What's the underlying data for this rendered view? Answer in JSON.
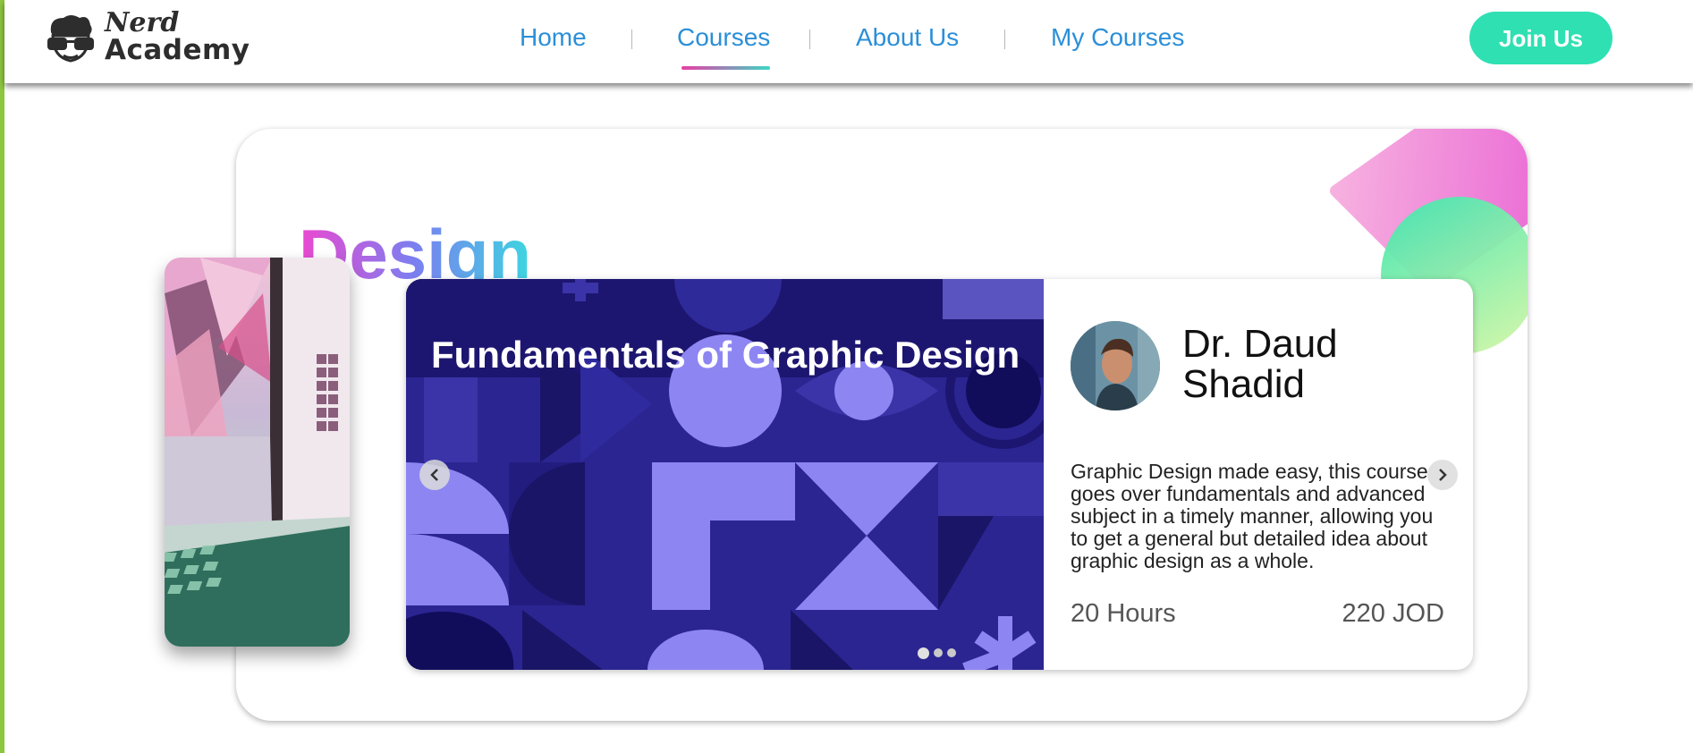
{
  "logo": {
    "line1": "Nerd",
    "line2": "Academy"
  },
  "nav": {
    "links": [
      {
        "label": "Home"
      },
      {
        "label": "Courses"
      },
      {
        "label": "About Us"
      },
      {
        "label": "My Courses"
      }
    ],
    "active_index": 1,
    "join_label": "Join Us"
  },
  "section": {
    "title": "Design"
  },
  "course": {
    "title": "Fundamentals of Graphic Design",
    "instructor": "Dr. Daud Shadid",
    "description": "Graphic Design made easy, this course goes over fundamentals and advanced subject in a timely manner, allowing you to get a general but detailed idea about graphic design as a whole.",
    "duration": "20 Hours",
    "price": "220 JOD",
    "slides_count": 3,
    "active_slide": 1
  },
  "icons": {
    "prev": "chevron-left-icon",
    "next": "chevron-right-icon",
    "logo": "nerd-glasses-face-icon"
  },
  "colors": {
    "nav_text": "#2b8fd8",
    "join_button": "#2fe0b2",
    "title_gradient_start": "#ec48d0",
    "title_gradient_end": "#3dd6e0",
    "course_image_bg": "#231a79",
    "left_edge": "#8dc63f"
  }
}
